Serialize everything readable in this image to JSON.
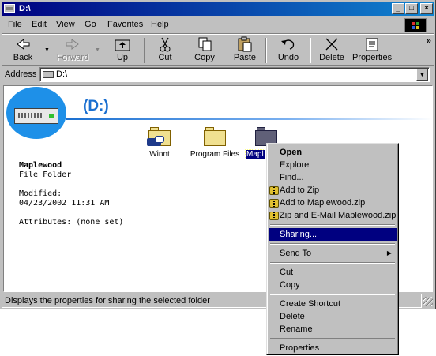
{
  "window": {
    "title": "D:\\"
  },
  "titlebar_buttons": {
    "minimize": "_",
    "maximize": "□",
    "close": "×"
  },
  "menubar": {
    "items": [
      {
        "label": "File",
        "mnemonic": "F",
        "rest": "ile"
      },
      {
        "label": "Edit",
        "mnemonic": "E",
        "rest": "dit"
      },
      {
        "label": "View",
        "mnemonic": "V",
        "rest": "iew"
      },
      {
        "label": "Go",
        "mnemonic": "G",
        "rest": "o"
      },
      {
        "label": "Favorites",
        "mnemonic": "a",
        "pre": "F",
        "rest": "vorites"
      },
      {
        "label": "Help",
        "mnemonic": "H",
        "rest": "elp"
      }
    ]
  },
  "toolbar": {
    "back": "Back",
    "forward": "Forward",
    "up": "Up",
    "cut": "Cut",
    "copy": "Copy",
    "paste": "Paste",
    "undo": "Undo",
    "delete": "Delete",
    "properties": "Properties",
    "more": "»"
  },
  "address": {
    "label": "Address",
    "value": "D:\\"
  },
  "content": {
    "drive_title": "(D:)",
    "selected_name": "Maplewood",
    "selected_type": "File Folder",
    "modified_label": "Modified:",
    "modified_value": "04/23/2002 11:31 AM",
    "attributes": "Attributes: (none set)",
    "folders": [
      "Winnt",
      "Program Files",
      "Mapl"
    ]
  },
  "context_menu": {
    "open": "Open",
    "explore": "Explore",
    "find": "Find...",
    "add_to_zip": "Add to Zip",
    "add_to_named_zip": "Add to Maplewood.zip",
    "zip_and_email": "Zip and E-Mail Maplewood.zip",
    "sharing": "Sharing...",
    "send_to": "Send To",
    "cut": "Cut",
    "copy": "Copy",
    "create_shortcut": "Create Shortcut",
    "delete": "Delete",
    "rename": "Rename",
    "properties": "Properties"
  },
  "status": {
    "text": "Displays the properties for sharing the selected folder"
  }
}
